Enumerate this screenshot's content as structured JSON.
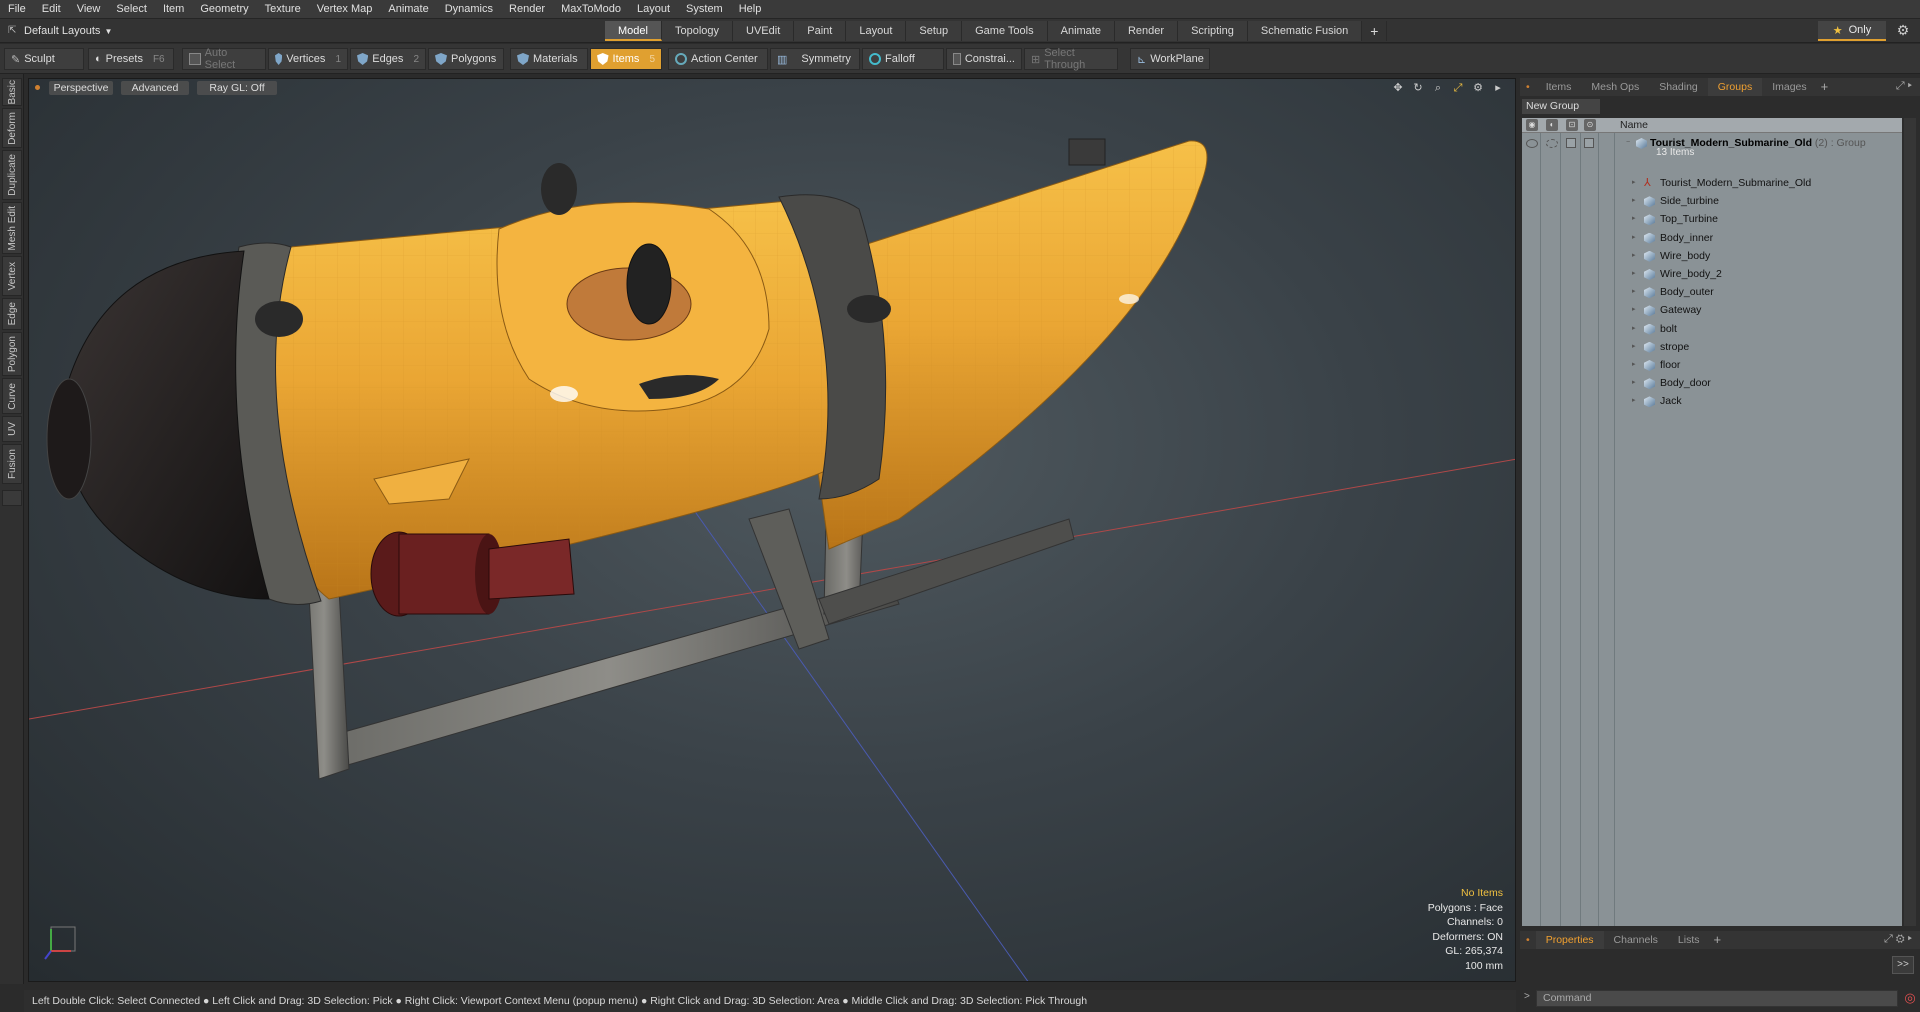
{
  "menu": [
    "File",
    "Edit",
    "View",
    "Select",
    "Item",
    "Geometry",
    "Texture",
    "Vertex Map",
    "Animate",
    "Dynamics",
    "Render",
    "MaxToModo",
    "Layout",
    "System",
    "Help"
  ],
  "layout_selector": "Default Layouts",
  "mode_tabs": [
    "Model",
    "Topology",
    "UVEdit",
    "Paint",
    "Layout",
    "Setup",
    "Game Tools",
    "Animate",
    "Render",
    "Scripting",
    "Schematic Fusion"
  ],
  "active_mode": "Model",
  "only_label": "Only",
  "toolbar": {
    "sculpt": "Sculpt",
    "presets": "Presets",
    "presets_key": "F6",
    "auto_select": "Auto Select",
    "vertices": "Vertices",
    "vertices_count": "1",
    "edges": "Edges",
    "edges_count": "2",
    "polygons": "Polygons",
    "materials": "Materials",
    "items": "Items",
    "items_count": "5",
    "action_center": "Action Center",
    "symmetry": "Symmetry",
    "falloff": "Falloff",
    "constraints": "Constrai...",
    "select_through": "Select Through",
    "workplane": "WorkPlane"
  },
  "side_tabs": [
    "Basic",
    "Deform",
    "Duplicate",
    "Mesh Edit",
    "Vertex",
    "Edge",
    "Polygon",
    "Curve",
    "UV",
    "Fusion"
  ],
  "viewport": {
    "view": "Perspective",
    "shading": "Advanced",
    "raygl": "Ray GL: Off",
    "info": {
      "selection": "No Items",
      "polygons": "Polygons : Face",
      "channels": "Channels: 0",
      "deformers": "Deformers: ON",
      "gl": "GL: 265,374",
      "unit": "100 mm"
    }
  },
  "status_hint": "Left Double Click: Select Connected ● Left Click and Drag: 3D Selection: Pick ● Right Click: Viewport Context Menu (popup menu) ● Right Click and Drag: 3D Selection: Area ● Middle Click and Drag: 3D Selection: Pick Through",
  "right_panel": {
    "tabs": [
      "Items",
      "Mesh Ops",
      "Shading",
      "Groups",
      "Images"
    ],
    "active_tab": "Groups",
    "new_group": "New Group",
    "column_name": "Name",
    "group": {
      "name": "Tourist_Modern_Submarine_Old",
      "count": "(2)",
      "type": ": Group",
      "items_label": "13 Items"
    },
    "items": [
      "Tourist_Modern_Submarine_Old",
      "Side_turbine",
      "Top_Turbine",
      "Body_inner",
      "Wire_body",
      "Wire_body_2",
      "Body_outer",
      "Gateway",
      "bolt",
      "strope",
      "floor",
      "Body_door",
      "Jack"
    ],
    "bottom_tabs": [
      "Properties",
      "Channels",
      "Lists"
    ],
    "active_bottom_tab": "Properties",
    "command_placeholder": "Command"
  },
  "colors": {
    "accent": "#e0a030",
    "hull": "#e8a838",
    "frame": "#5a5a58"
  }
}
